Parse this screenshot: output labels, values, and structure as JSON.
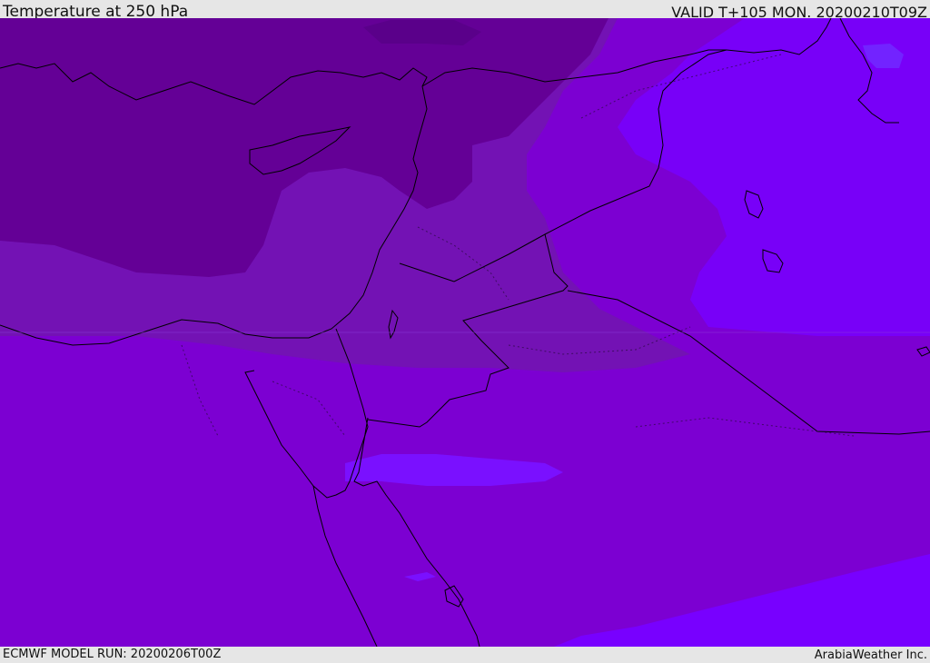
{
  "header": {
    "title": "Temperature at 250 hPa",
    "valid": "VALID T+105 MON. 20200210T09Z"
  },
  "footer": {
    "model_run": "ECMWF MODEL RUN: 20200206T00Z",
    "credit": "ArabiaWeather Inc."
  },
  "colors": {
    "coldest": "#640096",
    "cold": "#7312b4",
    "mid": "#7c00d2",
    "warm": "#7a00ee",
    "warmer": "#7800ff",
    "warmest": "#7223ff",
    "coastline": "#000000",
    "bar": "#e6e6e6"
  }
}
